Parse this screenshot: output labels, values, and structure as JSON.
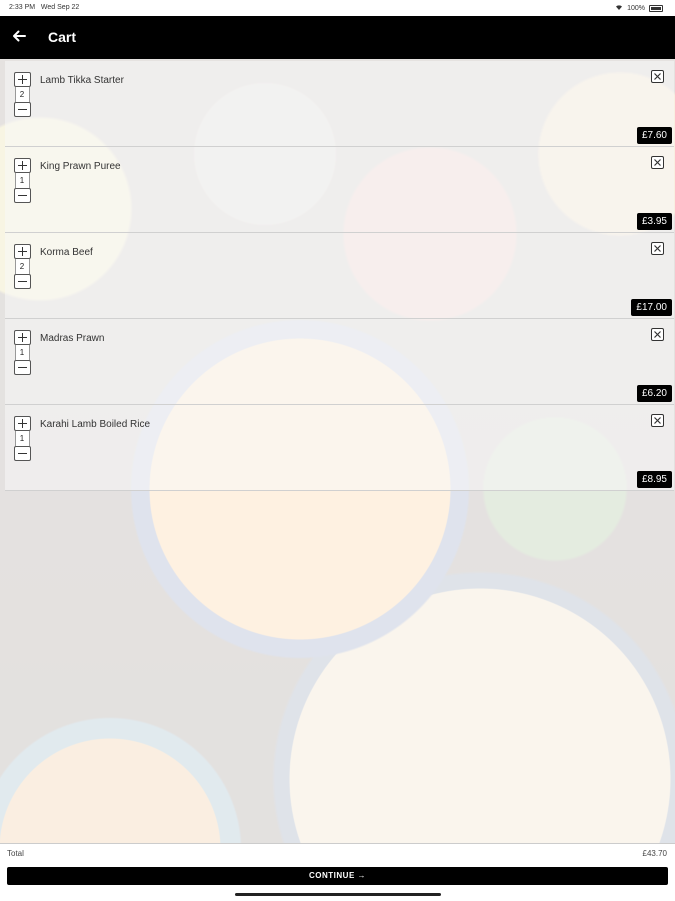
{
  "status_bar": {
    "time": "2:33 PM",
    "date": "Wed Sep 22",
    "battery": "100%"
  },
  "header": {
    "title": "Cart",
    "back_icon": "arrow-left-icon"
  },
  "cart": {
    "items": [
      {
        "name": "Lamb Tikka Starter",
        "qty": "2",
        "price": "£7.60"
      },
      {
        "name": "King Prawn Puree",
        "qty": "1",
        "price": "£3.95"
      },
      {
        "name": "Korma Beef",
        "qty": "2",
        "price": "£17.00"
      },
      {
        "name": "Madras Prawn",
        "qty": "1",
        "price": "£6.20"
      },
      {
        "name": "Karahi Lamb Boiled Rice",
        "qty": "1",
        "price": "£8.95"
      }
    ]
  },
  "footer": {
    "total_label": "Total",
    "total_value": "£43.70",
    "continue_label": "CONTINUE →"
  },
  "colors": {
    "header_bg": "#000000",
    "price_badge_bg": "#000000",
    "button_bg": "#000000"
  }
}
